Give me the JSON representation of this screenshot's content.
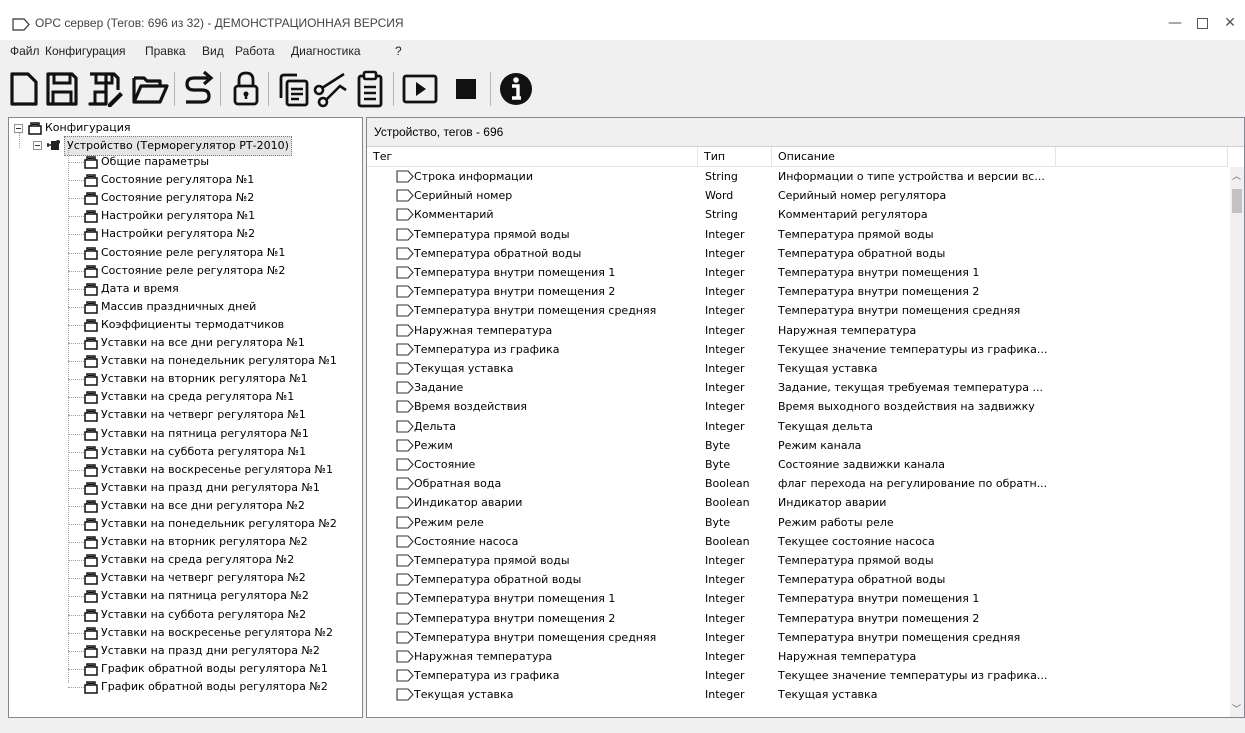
{
  "window": {
    "title": "OPC сервер (Тегов: 696 из 32) - ДЕМОНСТРАЦИОННАЯ ВЕРСИЯ",
    "minimize": "—",
    "close": "✕"
  },
  "menu": [
    "Файл",
    "Конфигурация",
    "Правка",
    "Вид",
    "Работа",
    "Диагностика",
    "?"
  ],
  "toolbar": {
    "buttons": [
      "new-file-icon",
      "save-icon",
      "save-as-icon",
      "open-folder-icon",
      "export-icon",
      "lock-icon",
      "copy-icon",
      "cut-icon",
      "paste-icon",
      "play-icon",
      "stop-icon",
      "info-icon"
    ]
  },
  "tree": {
    "root": "Конфигурация",
    "device": "Устройство (Терморегулятор РТ-2010)",
    "items": [
      "Общие параметры",
      "Состояние регулятора №1",
      "Состояние регулятора №2",
      "Настройки регулятора №1",
      "Настройки регулятора №2",
      "Состояние реле регулятора №1",
      "Состояние реле регулятора №2",
      "Дата и время",
      "Массив праздничных дней",
      "Коэффициенты термодатчиков",
      "Уставки на все дни регулятора №1",
      "Уставки на понедельник регулятора №1",
      "Уставки на вторник регулятора №1",
      "Уставки на среда регулятора №1",
      "Уставки на четверг регулятора №1",
      "Уставки на пятница регулятора №1",
      "Уставки на суббота регулятора №1",
      "Уставки на воскресенье регулятора №1",
      "Уставки на празд дни регулятора №1",
      "Уставки на все дни регулятора №2",
      "Уставки на понедельник регулятора №2",
      "Уставки на вторник регулятора №2",
      "Уставки на среда регулятора №2",
      "Уставки на четверг регулятора №2",
      "Уставки на пятница регулятора №2",
      "Уставки на суббота регулятора №2",
      "Уставки на воскресенье регулятора №2",
      "Уставки на празд дни регулятора №2",
      "График обратной воды регулятора №1",
      "График обратной воды регулятора №2"
    ]
  },
  "panel": {
    "title": "Устройство, тегов - 696",
    "columns": [
      "Тег",
      "Тип",
      "Описание"
    ],
    "rows": [
      [
        "Строка информации",
        "String",
        "Информации о типе устройства и версии вс..."
      ],
      [
        "Серийный номер",
        "Word",
        "Серийный номер регулятора"
      ],
      [
        "Комментарий",
        "String",
        "Комментарий регулятора"
      ],
      [
        "Температура прямой воды",
        "Integer",
        "Температура прямой воды"
      ],
      [
        "Температура обратной воды",
        "Integer",
        "Температура обратной воды"
      ],
      [
        "Температура внутри помещения 1",
        "Integer",
        "Температура внутри помещения 1"
      ],
      [
        "Температура внутри помещения 2",
        "Integer",
        "Температура внутри помещения 2"
      ],
      [
        "Температура внутри помещения средняя",
        "Integer",
        "Температура внутри помещения средняя"
      ],
      [
        "Наружная температура",
        "Integer",
        "Наружная температура"
      ],
      [
        "Температура из графика",
        "Integer",
        "Текущее значение температуры из графика..."
      ],
      [
        "Текущая уставка",
        "Integer",
        "Текущая уставка"
      ],
      [
        "Задание",
        "Integer",
        "Задание, текущая требуемая температура ..."
      ],
      [
        "Время воздействия",
        "Integer",
        "Время выходного воздействия на задвижку"
      ],
      [
        "Дельта",
        "Integer",
        "Текущая дельта"
      ],
      [
        "Режим",
        "Byte",
        "Режим канала"
      ],
      [
        "Состояние",
        "Byte",
        "Состояние задвижки канала"
      ],
      [
        "Обратная вода",
        "Boolean",
        "флаг перехода на регулирование по обратн..."
      ],
      [
        "Индикатор аварии",
        "Boolean",
        "Индикатор аварии"
      ],
      [
        "Режим реле",
        "Byte",
        "Режим работы реле"
      ],
      [
        "Состояние насоса",
        "Boolean",
        "Текущее состояние насоса"
      ],
      [
        "Температура прямой воды",
        "Integer",
        "Температура прямой воды"
      ],
      [
        "Температура обратной воды",
        "Integer",
        "Температура обратной воды"
      ],
      [
        "Температура внутри помещения 1",
        "Integer",
        "Температура внутри помещения 1"
      ],
      [
        "Температура внутри помещения 2",
        "Integer",
        "Температура внутри помещения 2"
      ],
      [
        "Температура внутри помещения средняя",
        "Integer",
        "Температура внутри помещения средняя"
      ],
      [
        "Наружная температура",
        "Integer",
        "Наружная температура"
      ],
      [
        "Температура из графика",
        "Integer",
        "Текущее значение температуры из графика..."
      ],
      [
        "Текущая уставка",
        "Integer",
        "Текущая уставка"
      ]
    ]
  }
}
